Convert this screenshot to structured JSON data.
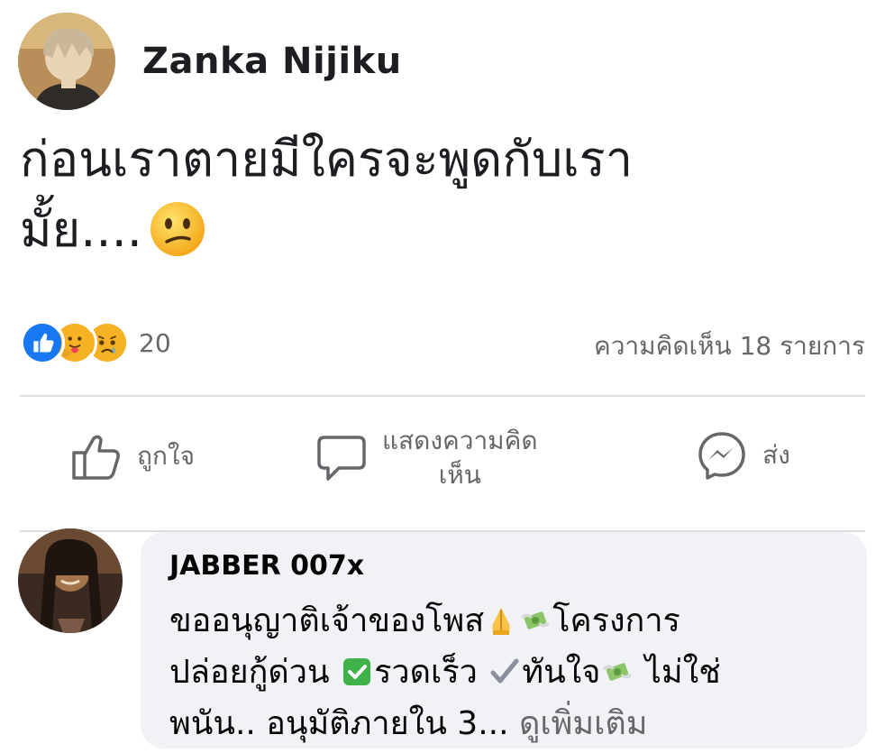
{
  "post": {
    "author": "Zanka Nijiku",
    "text_line1": "ก่อนเราตายมีใครจะพูดกับเรา",
    "text_line2": "มั้ย....",
    "reaction_count": "20",
    "comment_count": "ความคิดเห็น 18 รายการ"
  },
  "actions": {
    "like_label": "ถูกใจ",
    "comment_label_line1": "แสดงความคิด",
    "comment_label_line2": "เห็น",
    "send_label": "ส่ง"
  },
  "comment": {
    "author": "JABBER 007x",
    "part1": "ขออนุญาติเจ้าของโพส",
    "part2": "โครงการ",
    "part3": "ปล่อยกู้ด่วน",
    "part4": "รวดเร็ว",
    "part5": "ทันใจ",
    "part6": " ไม่ใช่",
    "part7": "พนัน.. อนุมัติภายใน 3... ",
    "see_more": "ดูเพิ่มเติม"
  },
  "colors": {
    "like_blue": "#1877f2",
    "text_primary": "#1c1e21",
    "text_secondary": "#65676b",
    "bubble_bg": "#f0f2f5",
    "divider": "#dadde1"
  },
  "icons": {
    "reactions": [
      "like-reaction-icon",
      "care-reaction-icon",
      "sad-reaction-icon"
    ],
    "actions": [
      "thumbs-up-icon",
      "speech-bubble-icon",
      "messenger-icon"
    ],
    "post_emoji": "confused-face-emoji",
    "comment_emojis": [
      "folded-hands-emoji",
      "money-with-wings-emoji",
      "check-mark-button-emoji",
      "check-mark-emoji"
    ]
  }
}
